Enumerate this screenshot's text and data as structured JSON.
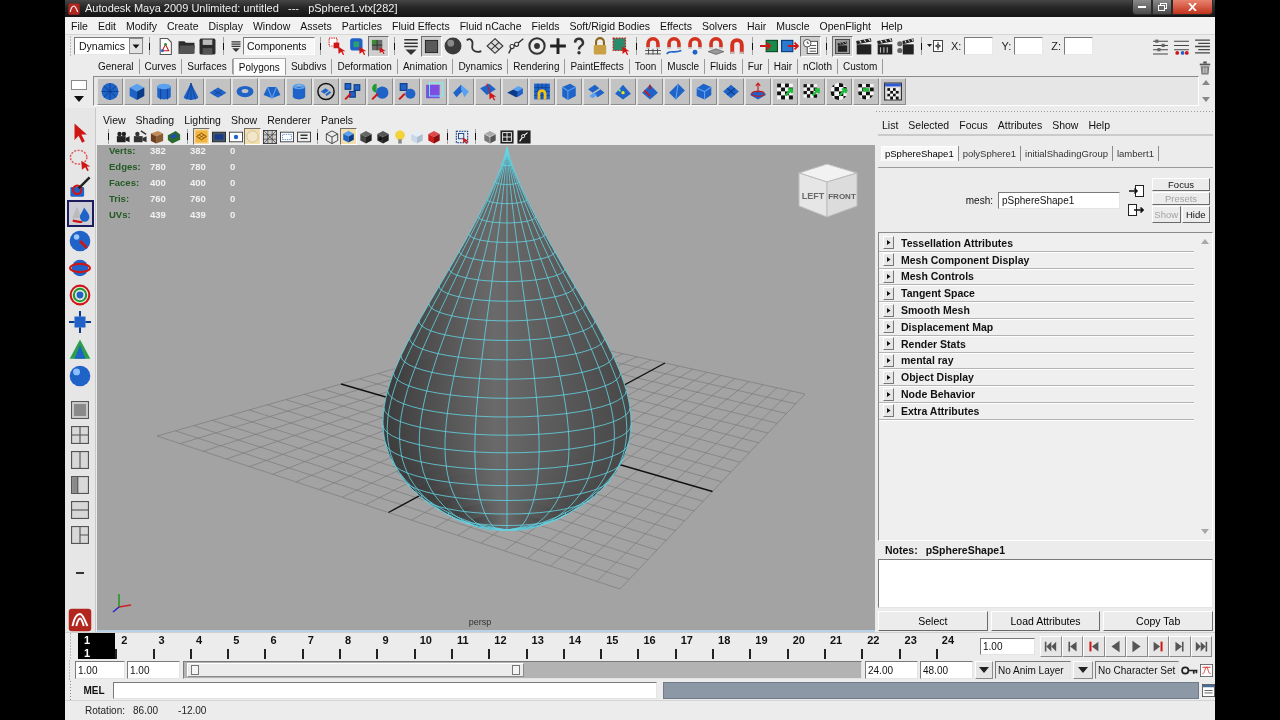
{
  "window": {
    "title": "Autodesk Maya 2009 Unlimited: untitled   ---   pSphere1.vtx[282]"
  },
  "menu_bar": [
    "File",
    "Edit",
    "Modify",
    "Create",
    "Display",
    "Window",
    "Assets",
    "Particles",
    "Fluid Effects",
    "Fluid nCache",
    "Fields",
    "Soft/Rigid Bodies",
    "Effects",
    "Solvers",
    "Hair",
    "Muscle",
    "OpenFlight",
    "Help"
  ],
  "status_line": {
    "menu_set": "Dynamics",
    "selection_mode": "Components",
    "select_modes": [
      {
        "kind": "hierarchy",
        "on": false
      },
      {
        "kind": "object",
        "on": false
      },
      {
        "kind": "component",
        "on": true
      }
    ],
    "mask_types": [
      {
        "kind": "mask_menu",
        "on": false
      },
      {
        "kind": "square",
        "on": true
      },
      {
        "kind": "sphere",
        "on": false
      },
      {
        "kind": "curve",
        "on": false
      },
      {
        "kind": "plane",
        "on": false
      },
      {
        "kind": "joint",
        "on": false
      },
      {
        "kind": "target",
        "on": false
      },
      {
        "kind": "plus",
        "on": false
      },
      {
        "kind": "question",
        "on": false
      },
      {
        "kind": "lock",
        "on": false
      },
      {
        "kind": "frame",
        "on": false
      }
    ],
    "snap_modes": [
      {
        "kind": "grid",
        "on": false
      },
      {
        "kind": "curve",
        "on": false
      },
      {
        "kind": "point",
        "on": false
      },
      {
        "kind": "plane",
        "on": false
      },
      {
        "kind": "surface",
        "on": false
      }
    ],
    "history": [
      {
        "kind": "inputs",
        "on": false
      },
      {
        "kind": "outputs",
        "on": false
      },
      {
        "kind": "history",
        "on": true
      }
    ],
    "render": [
      {
        "kind": "frame",
        "on": true
      },
      {
        "kind": "render",
        "on": false
      },
      {
        "kind": "ipr",
        "on": false
      },
      {
        "kind": "settings",
        "on": false
      }
    ],
    "coordinate_labels": [
      "X:",
      "Y:",
      "Z:"
    ]
  },
  "shelf_tabs": [
    {
      "label": "General",
      "selected": false
    },
    {
      "label": "Curves",
      "selected": false
    },
    {
      "label": "Surfaces",
      "selected": false
    },
    {
      "label": "Polygons",
      "selected": true
    },
    {
      "label": "Subdivs",
      "selected": false
    },
    {
      "label": "Deformation",
      "selected": false
    },
    {
      "label": "Animation",
      "selected": false
    },
    {
      "label": "Dynamics",
      "selected": false
    },
    {
      "label": "Rendering",
      "selected": false
    },
    {
      "label": "PaintEffects",
      "selected": false
    },
    {
      "label": "Toon",
      "selected": false
    },
    {
      "label": "Muscle",
      "selected": false
    },
    {
      "label": "Fluids",
      "selected": false
    },
    {
      "label": "Fur",
      "selected": false
    },
    {
      "label": "Hair",
      "selected": false
    },
    {
      "label": "nCloth",
      "selected": false
    },
    {
      "label": "Custom",
      "selected": false
    }
  ],
  "toolbox": [
    {
      "kind": "select",
      "selected": false
    },
    {
      "kind": "lasso",
      "selected": false
    },
    {
      "kind": "paint",
      "selected": false
    },
    {
      "kind": "sculpt",
      "selected": true
    },
    {
      "kind": "move",
      "selected": false
    },
    {
      "kind": "rotate",
      "selected": false
    },
    {
      "kind": "scale",
      "selected": false
    },
    {
      "kind": "manipulator",
      "selected": false
    },
    {
      "kind": "soft_mod",
      "selected": false
    },
    {
      "kind": "last_tool",
      "selected": false
    }
  ],
  "viewport": {
    "menu": [
      "View",
      "Shading",
      "Lighting",
      "Show",
      "Renderer",
      "Panels"
    ],
    "toolbar": [
      [
        {
          "kind": "camera",
          "on": false
        },
        {
          "kind": "camera_attributes",
          "on": false
        },
        {
          "kind": "bookmarks",
          "on": false
        },
        {
          "kind": "image_plane",
          "on": false
        }
      ],
      [
        {
          "kind": "grid",
          "on": true
        },
        {
          "kind": "film_gate",
          "on": false
        },
        {
          "kind": "resolution_gate",
          "on": false
        },
        {
          "kind": "gate_mask",
          "on": true
        },
        {
          "kind": "field_chart",
          "on": false
        },
        {
          "kind": "safe_action",
          "on": false
        },
        {
          "kind": "safe_title",
          "on": false
        }
      ],
      [
        {
          "kind": "wireframe",
          "on": false
        },
        {
          "kind": "smooth_shade",
          "on": true
        },
        {
          "kind": "flat_shade",
          "on": false
        },
        {
          "kind": "shade_selected",
          "on": false
        },
        {
          "kind": "lights",
          "on": false
        },
        {
          "kind": "xray",
          "on": false
        },
        {
          "kind": "textured",
          "on": false
        }
      ],
      [
        {
          "kind": "isolate",
          "on": false
        }
      ],
      [
        {
          "kind": "xray_joints",
          "on": false
        },
        {
          "kind": "component_mode",
          "on": false
        },
        {
          "kind": "joint",
          "on": false
        }
      ]
    ],
    "hud": [
      {
        "label": "Verts:",
        "values": [
          "382",
          "382",
          "0"
        ]
      },
      {
        "label": "Edges:",
        "values": [
          "780",
          "780",
          "0"
        ]
      },
      {
        "label": "Faces:",
        "values": [
          "400",
          "400",
          "0"
        ]
      },
      {
        "label": "Tris:",
        "values": [
          "760",
          "760",
          "0"
        ]
      },
      {
        "label": "UVs:",
        "values": [
          "439",
          "439",
          "0"
        ]
      }
    ],
    "view_cube": [
      "LEFT",
      "FRONT"
    ],
    "camera": "persp"
  },
  "attribute_editor": {
    "menu": [
      "List",
      "Selected",
      "Focus",
      "Attributes",
      "Show",
      "Help"
    ],
    "tabs": [
      {
        "label": "pSphereShape1",
        "selected": true
      },
      {
        "label": "polySphere1",
        "selected": false
      },
      {
        "label": "initialShadingGroup",
        "selected": false
      },
      {
        "label": "lambert1",
        "selected": false
      }
    ],
    "node_type_label": "mesh:",
    "node_name": "pSphereShape1",
    "node_buttons": [
      {
        "label": "Focus",
        "disabled": false
      },
      {
        "label": "Presets",
        "disabled": true
      },
      {
        "label": "Show",
        "disabled": true
      },
      {
        "label": "Hide",
        "disabled": false
      }
    ],
    "sections": [
      {
        "label": "Tessellation Attributes",
        "expanded": false
      },
      {
        "label": "Mesh Component Display",
        "expanded": false
      },
      {
        "label": "Mesh Controls",
        "expanded": false
      },
      {
        "label": "Tangent Space",
        "expanded": false
      },
      {
        "label": "Smooth Mesh",
        "expanded": false
      },
      {
        "label": "Displacement Map",
        "expanded": false
      },
      {
        "label": "Render Stats",
        "expanded": false
      },
      {
        "label": "mental ray",
        "expanded": false
      },
      {
        "label": "Object Display",
        "expanded": false
      },
      {
        "label": "Node Behavior",
        "expanded": false
      },
      {
        "label": "Extra Attributes",
        "expanded": false
      }
    ],
    "notes_label": "Notes:",
    "notes_node": "pSphereShape1",
    "buttons": [
      "Select",
      "Load Attributes",
      "Copy Tab"
    ]
  },
  "time_slider": {
    "frames": [
      {
        "label": "1",
        "selected": true
      },
      {
        "label": "2",
        "selected": false
      },
      {
        "label": "3",
        "selected": false
      },
      {
        "label": "4",
        "selected": false
      },
      {
        "label": "5",
        "selected": false
      },
      {
        "label": "6",
        "selected": false
      },
      {
        "label": "7",
        "selected": false
      },
      {
        "label": "8",
        "selected": false
      },
      {
        "label": "9",
        "selected": false
      },
      {
        "label": "10",
        "selected": false
      },
      {
        "label": "11",
        "selected": false
      },
      {
        "label": "12",
        "selected": false
      },
      {
        "label": "13",
        "selected": false
      },
      {
        "label": "14",
        "selected": false
      },
      {
        "label": "15",
        "selected": false
      },
      {
        "label": "16",
        "selected": false
      },
      {
        "label": "17",
        "selected": false
      },
      {
        "label": "18",
        "selected": false
      },
      {
        "label": "19",
        "selected": false
      },
      {
        "label": "20",
        "selected": false
      },
      {
        "label": "21",
        "selected": false
      },
      {
        "label": "22",
        "selected": false
      },
      {
        "label": "23",
        "selected": false
      },
      {
        "label": "24",
        "selected": false
      }
    ],
    "current_frame": "1",
    "current_time": "1.00"
  },
  "range_slider": {
    "start_time": "1.00",
    "playback_start": "1.00",
    "playback_end": "24.00",
    "end_time": "48.00",
    "level": 0.5
  },
  "anim_layer": "No Anim Layer",
  "character_set": "No Character Set",
  "command_line": {
    "language": "MEL"
  },
  "help_line": {
    "label": "Rotation:",
    "values": [
      "86.00",
      "-12.00"
    ]
  }
}
